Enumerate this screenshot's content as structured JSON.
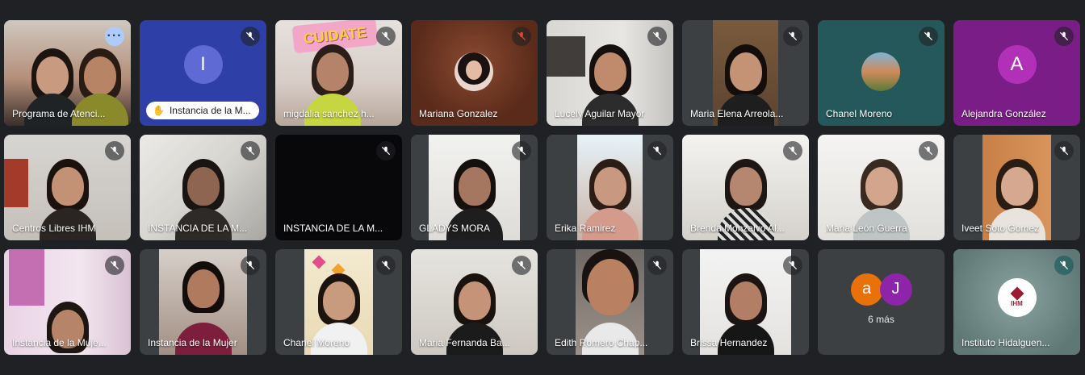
{
  "app": {
    "title": ""
  },
  "tiles": [
    {
      "name": "Programa de Atenci...",
      "speaking": true,
      "more": true
    },
    {
      "name": "",
      "avatar_letter": "I",
      "avatar_color": "#5f6ad4",
      "bg": "#2f3fa8",
      "hand_badge": "Instancia de la M..."
    },
    {
      "name": "migdalia sanchez h...",
      "poster": "CUIDATE"
    },
    {
      "name": "Mariana Gonzalez"
    },
    {
      "name": "Lucely Aguilar Mayor"
    },
    {
      "name": "Maria Elena Arreola..."
    },
    {
      "name": "Chanel Moreno"
    },
    {
      "name": "Alejandra González",
      "avatar_letter": "A",
      "avatar_color": "#b230b8",
      "bg": "#7b1d86"
    },
    {
      "name": "Centros Libres IHM"
    },
    {
      "name": "INSTANCIA DE LA M..."
    },
    {
      "name": "INSTANCIA DE LA M..."
    },
    {
      "name": "GLADYS MORA"
    },
    {
      "name": "Erika Ramirez"
    },
    {
      "name": "Brenda Monzalvo Al..."
    },
    {
      "name": "Maria León Guerra"
    },
    {
      "name": "Iveet Soto Gomez"
    },
    {
      "name": "Instancia de la Muje..."
    },
    {
      "name": "Instancia de la Mujer"
    },
    {
      "name": "Chanel Moreno"
    },
    {
      "name": "Maria Fernanda Ba..."
    },
    {
      "name": "Edith Romero Chap..."
    },
    {
      "name": "Brissa Hernandez"
    },
    {
      "name": ""
    },
    {
      "name": "Instituto Hidalguen..."
    }
  ],
  "overflow": {
    "label": "6 más",
    "avatars": [
      {
        "letter": "a",
        "color": "#e8710a"
      },
      {
        "letter": "J",
        "color": "#8e24aa"
      }
    ]
  },
  "institute_logo": "IHM",
  "icons": {
    "mic_off": "mic-off-icon",
    "more": "more-options-icon",
    "hand": "raised-hand-icon"
  }
}
